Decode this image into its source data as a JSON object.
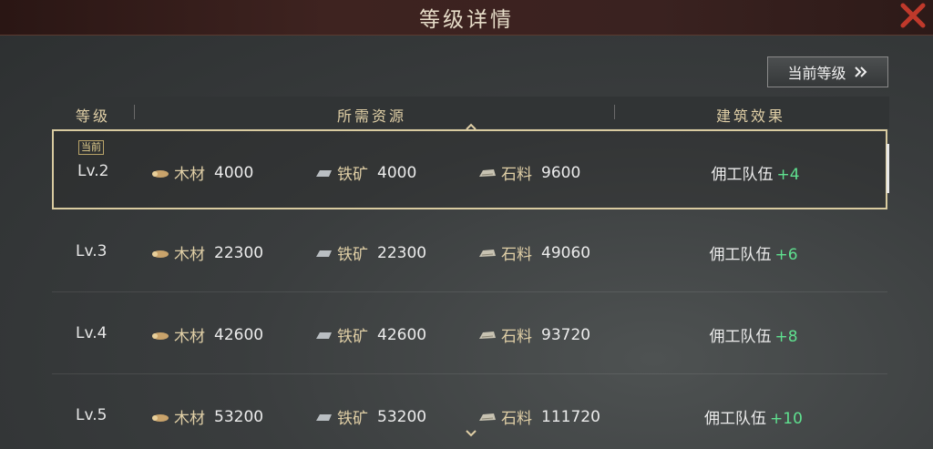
{
  "window": {
    "title": "等级详情"
  },
  "current_level_button": {
    "label": "当前等级"
  },
  "table": {
    "headers": {
      "level": "等级",
      "resources": "所需资源",
      "effect": "建筑效果"
    },
    "current_badge": "当前",
    "rows": [
      {
        "level": "Lv.2",
        "wood_label": "木材",
        "wood": "4000",
        "iron_label": "铁矿",
        "iron": "4000",
        "stone_label": "石料",
        "stone": "9600",
        "effect_label": "佣工队伍",
        "effect_value": "+4",
        "current": true
      },
      {
        "level": "Lv.3",
        "wood_label": "木材",
        "wood": "22300",
        "iron_label": "铁矿",
        "iron": "22300",
        "stone_label": "石料",
        "stone": "49060",
        "effect_label": "佣工队伍",
        "effect_value": "+6",
        "current": false
      },
      {
        "level": "Lv.4",
        "wood_label": "木材",
        "wood": "42600",
        "iron_label": "铁矿",
        "iron": "42600",
        "stone_label": "石料",
        "stone": "93720",
        "effect_label": "佣工队伍",
        "effect_value": "+8",
        "current": false
      },
      {
        "level": "Lv.5",
        "wood_label": "木材",
        "wood": "53200",
        "iron_label": "铁矿",
        "iron": "53200",
        "stone_label": "石料",
        "stone": "111720",
        "effect_label": "佣工队伍",
        "effect_value": "+10",
        "current": false
      }
    ]
  },
  "icons": {
    "close": "close-x-icon",
    "wood": "wood-log-icon",
    "iron": "iron-ingot-icon",
    "stone": "stone-block-icon",
    "forward": "double-chevron-right-icon"
  },
  "colors": {
    "accent_gold": "#e0cfa6",
    "bonus_green": "#5fe08f",
    "close_red": "#c0392b"
  }
}
